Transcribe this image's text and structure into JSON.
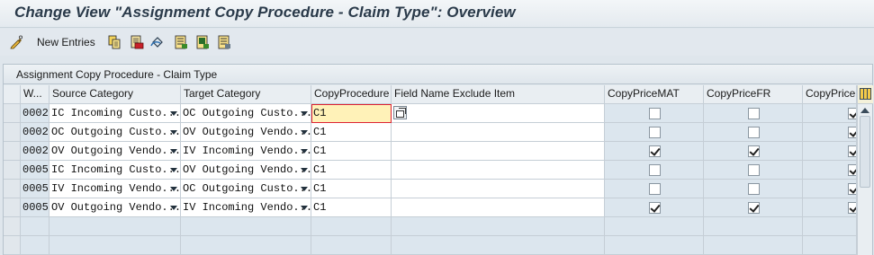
{
  "window": {
    "title": "Change View \"Assignment Copy Procedure - Claim Type\": Overview"
  },
  "toolbar": {
    "new_entries_label": "New Entries",
    "icons": [
      "display-change-icon",
      "copy-icon",
      "delete-icon",
      "undo-change-icon",
      "select-all-icon",
      "select-block-icon",
      "deselect-all-icon"
    ]
  },
  "table": {
    "title": "Assignment Copy Procedure - Claim Type",
    "columns": [
      "W...",
      "Source Category",
      "Target Category",
      "CopyProcedure",
      "Field Name Exclude Item",
      "CopyPriceMAT",
      "CopyPriceFR",
      "CopyPriceS"
    ],
    "rows": [
      {
        "w": "0002",
        "source": "IC Incoming Custo...",
        "target": "OC Outgoing Custo...",
        "proc": "C1",
        "exclude": "",
        "mat": false,
        "fr": false,
        "s": true
      },
      {
        "w": "0002",
        "source": "OC Outgoing Custo...",
        "target": "OV Outgoing Vendo...",
        "proc": "C1",
        "exclude": "",
        "mat": false,
        "fr": false,
        "s": true
      },
      {
        "w": "0002",
        "source": "OV Outgoing Vendo...",
        "target": "IV Incoming Vendo...",
        "proc": "C1",
        "exclude": "",
        "mat": true,
        "fr": true,
        "s": true
      },
      {
        "w": "0005",
        "source": "IC Incoming Custo...",
        "target": "OV Outgoing Vendo...",
        "proc": "C1",
        "exclude": "",
        "mat": false,
        "fr": false,
        "s": true
      },
      {
        "w": "0005",
        "source": "IV Incoming Vendo...",
        "target": "OC Outgoing Custo...",
        "proc": "C1",
        "exclude": "",
        "mat": false,
        "fr": false,
        "s": true
      },
      {
        "w": "0005",
        "source": "OV Outgoing Vendo...",
        "target": "IV Incoming Vendo...",
        "proc": "C1",
        "exclude": "",
        "mat": true,
        "fr": true,
        "s": true
      }
    ],
    "focused_cell": {
      "row": 0,
      "column": "CopyProcedure"
    }
  },
  "colors": {
    "focus_fill": "#fff2b8",
    "focus_border": "#dd2233",
    "key_column": "#dce6ee",
    "header": "#e9eef2"
  }
}
